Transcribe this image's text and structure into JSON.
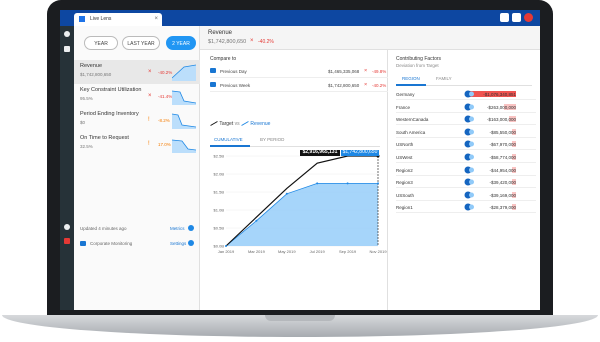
{
  "window": {
    "tab_title": "Live Lens",
    "tab_close": "×"
  },
  "periods": [
    {
      "label": "YEAR",
      "active": false
    },
    {
      "label": "LAST YEAR",
      "active": false
    },
    {
      "label": "2 YEAR",
      "active": true
    }
  ],
  "metrics": [
    {
      "name": "Revenue",
      "value": "$1,742,800,650",
      "mark": "×",
      "pct": "-40.2%",
      "selected": true
    },
    {
      "name": "Key Constraint Utilization",
      "value": "95.5%",
      "mark": "×",
      "pct": "-41.4%",
      "selected": false
    },
    {
      "name": "Period Ending Inventory",
      "value": "$0",
      "mark": "!",
      "pct": "-8.2%",
      "selected": false
    },
    {
      "name": "On Time to Request",
      "value": "32.5%",
      "mark": "!",
      "pct": "17.0%",
      "selected": false
    }
  ],
  "left_footer": {
    "updated": "Updated 4 minutes ago",
    "metrics_link": "Metrics",
    "corporate": "Corporate Monitoring",
    "settings_link": "Settings"
  },
  "header": {
    "title": "Revenue",
    "value": "$1,742,800,650",
    "mark": "×",
    "pct": "-40.2%"
  },
  "compare": {
    "title": "Compare to",
    "rows": [
      {
        "label": "Previous Day",
        "value": "$1,465,335,068",
        "mark": "×",
        "pct": "-49.8%"
      },
      {
        "label": "Previous Week",
        "value": "$1,742,800,650",
        "mark": "×",
        "pct": "-40.2%"
      }
    ]
  },
  "legend": {
    "target": "Target",
    "vs": "vs",
    "revenue": "Revenue"
  },
  "chart_tabs": [
    "CUMULATIVE",
    "BY PERIOD"
  ],
  "chart_data": {
    "type": "area",
    "x": [
      "Jan 2019",
      "Mar 2019",
      "May 2019",
      "Jul 2019",
      "Sep 2019",
      "Nov 2019"
    ],
    "yticks": [
      "$0.0B",
      "$0.5B",
      "$1.0B",
      "$1.5B",
      "$2.0B",
      "$2.5B"
    ],
    "series": [
      {
        "name": "Target",
        "values": [
          0.0,
          0.8,
          1.6,
          2.3,
          2.92,
          2.92
        ]
      },
      {
        "name": "Revenue",
        "values": [
          0.0,
          0.7,
          1.45,
          1.74,
          1.74,
          1.74
        ]
      }
    ],
    "callouts": {
      "target": "$2,916,965,131",
      "revenue": "$1,742,800,650"
    },
    "colors": {
      "target": "#111111",
      "revenue": "#90caf9",
      "revenue_line": "#1e88e5"
    }
  },
  "factors": {
    "title": "Contributing Factors",
    "subtitle": "Deviation from Target",
    "tabs": [
      "REGION",
      "FAMILY"
    ],
    "rows": [
      {
        "name": "Germany",
        "value": "-$1,076,340,851",
        "magnitude": 1.0
      },
      {
        "name": "France",
        "value": "-$263,000,000",
        "magnitude": 0.24
      },
      {
        "name": "WesternCanada",
        "value": "-$163,000,000",
        "magnitude": 0.15
      },
      {
        "name": "South America",
        "value": "-$85,550,000",
        "magnitude": 0.08
      },
      {
        "name": "USNorth",
        "value": "-$67,970,000",
        "magnitude": 0.06
      },
      {
        "name": "USWest",
        "value": "-$58,774,000",
        "magnitude": 0.05
      },
      {
        "name": "Region2",
        "value": "-$44,954,000",
        "magnitude": 0.04
      },
      {
        "name": "Region3",
        "value": "-$39,420,000",
        "magnitude": 0.04
      },
      {
        "name": "USSouth",
        "value": "-$39,169,000",
        "magnitude": 0.04
      },
      {
        "name": "Region1",
        "value": "-$28,379,000",
        "magnitude": 0.03
      }
    ]
  }
}
